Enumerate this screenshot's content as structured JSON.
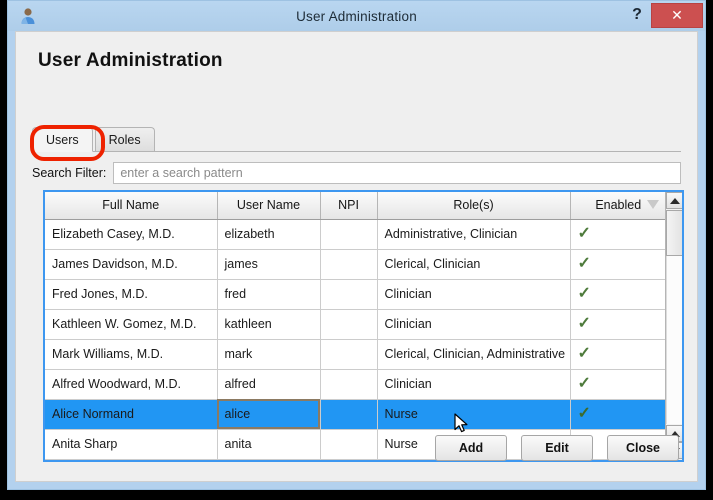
{
  "window": {
    "title": "User Administration",
    "icon": "user-icon",
    "help_label": "?",
    "close_label": "✕",
    "accent_title_bar": "#b3d1ee",
    "close_button_color": "#cc5050"
  },
  "page": {
    "heading": "User Administration"
  },
  "annotation": {
    "shape": "oval",
    "color": "#ee2200",
    "targets": "users-tab"
  },
  "tabs": [
    {
      "label": "Users",
      "active": true
    },
    {
      "label": "Roles",
      "active": false
    }
  ],
  "search": {
    "label": "Search Filter:",
    "placeholder": "enter a search pattern",
    "value": ""
  },
  "table": {
    "columns": [
      "Full Name",
      "User Name",
      "NPI",
      "Role(s)",
      "Enabled"
    ],
    "sort_column": "Enabled",
    "rows": [
      {
        "full_name": "Elizabeth Casey, M.D.",
        "user_name": "elizabeth",
        "npi": "",
        "roles": "Administrative, Clinician",
        "enabled": "✓",
        "selected": false
      },
      {
        "full_name": "James Davidson, M.D.",
        "user_name": "james",
        "npi": "",
        "roles": "Clerical, Clinician",
        "enabled": "✓",
        "selected": false
      },
      {
        "full_name": "Fred Jones, M.D.",
        "user_name": "fred",
        "npi": "",
        "roles": "Clinician",
        "enabled": "✓",
        "selected": false
      },
      {
        "full_name": "Kathleen W. Gomez, M.D.",
        "user_name": "kathleen",
        "npi": "",
        "roles": "Clinician",
        "enabled": "✓",
        "selected": false
      },
      {
        "full_name": "Mark Williams, M.D.",
        "user_name": "mark",
        "npi": "",
        "roles": "Clerical, Clinician, Administrative",
        "enabled": "✓",
        "selected": false
      },
      {
        "full_name": "Alfred Woodward, M.D.",
        "user_name": "alfred",
        "npi": "",
        "roles": "Clinician",
        "enabled": "✓",
        "selected": false
      },
      {
        "full_name": "Alice Normand",
        "user_name": "alice",
        "npi": "",
        "roles": "Nurse",
        "enabled": "✓",
        "selected": true
      },
      {
        "full_name": "Anita Sharp",
        "user_name": "anita",
        "npi": "",
        "roles": "Nurse",
        "enabled": "✓",
        "selected": false
      }
    ],
    "selected_row_color": "#2196f3",
    "check_color": "#4e7b3c"
  },
  "buttons": {
    "add": "Add",
    "edit": "Edit",
    "close": "Close"
  }
}
